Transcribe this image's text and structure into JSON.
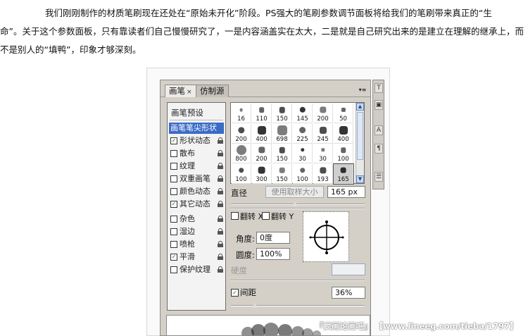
{
  "article": {
    "line1": "我们刚刚制作的材质笔刷现在还处在“原始未开化”阶段。PS强大的笔刷参数调节面板将给我们的笔刷带来真正的“生",
    "line2": "命”。关于这个参数面板，只有靠读者们自己慢慢研究了，一是内容涵盖实在太大，二是就是自己研究出来的是建立在理解的继承上，而",
    "line3": "不是别人的“填鸭”，印象才够深刻。"
  },
  "panel": {
    "tabs": [
      {
        "label": "画笔",
        "close": "×"
      },
      {
        "label": "仿制源"
      }
    ],
    "menu_icon": "▾≡",
    "list_title": "画笔预设",
    "items": [
      {
        "label": "画笔笔尖形状",
        "selected": true
      },
      {
        "label": "形状动态",
        "checked": true,
        "lock": true
      },
      {
        "label": "散布",
        "checked": false,
        "lock": true
      },
      {
        "label": "纹理",
        "checked": false,
        "lock": true
      },
      {
        "label": "双重画笔",
        "checked": false,
        "lock": true
      },
      {
        "label": "颜色动态",
        "checked": false,
        "lock": true
      },
      {
        "label": "其它动态",
        "checked": true,
        "lock": true
      },
      {
        "label": "杂色",
        "checked": false,
        "lock": true
      },
      {
        "label": "湿边",
        "checked": false,
        "lock": true
      },
      {
        "label": "喷枪",
        "checked": false,
        "lock": true
      },
      {
        "label": "平滑",
        "checked": true,
        "lock": true
      },
      {
        "label": "保护纹理",
        "checked": false,
        "lock": true
      }
    ],
    "brush_sizes": [
      "16",
      "110",
      "150",
      "145",
      "200",
      "50",
      "200",
      "400",
      "698",
      "225",
      "245",
      "400",
      "800",
      "200",
      "150",
      "30",
      "30",
      "100",
      "100",
      "300",
      "150",
      "100",
      "193",
      "165"
    ],
    "selected_brush": "165",
    "diameter_label": "直径",
    "sample_size_button": "使用取样大小",
    "diameter_value": "165 px",
    "flip_x_label": "翻转 X",
    "flip_y_label": "翻转 Y",
    "angle_label": "角度:",
    "angle_value": "0度",
    "roundness_label": "圆度:",
    "roundness_value": "100%",
    "hardness_label": "硬度",
    "spacing_label": "间距",
    "spacing_checked": true,
    "spacing_value": "36%",
    "diameter_slider": 0.48,
    "spacing_slider": 0.18
  },
  "watermark": "『疯画论画吧』 【www.lineeg.com/tieba/1797】"
}
